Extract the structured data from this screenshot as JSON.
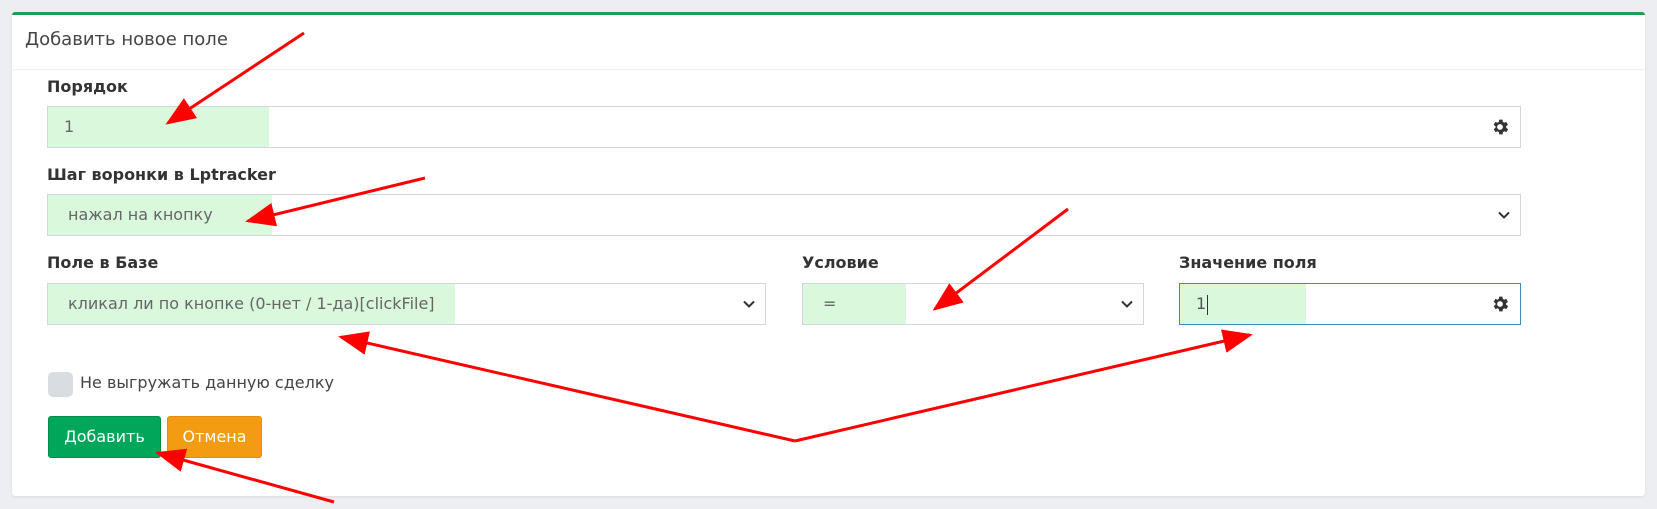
{
  "header": {
    "title": "Добавить новое поле"
  },
  "form": {
    "order": {
      "label": "Порядок",
      "value": "1",
      "icon": "gear-icon"
    },
    "funnel_step": {
      "label": "Шаг воронки в Lptracker",
      "selected": "нажал на кнопку"
    },
    "db_field": {
      "label": "Поле в Базе",
      "selected": "кликал ли по кнопке (0-нет / 1-да)[clickFile]"
    },
    "condition": {
      "label": "Условие",
      "selected": "="
    },
    "field_value": {
      "label": "Значение поля",
      "value": "1",
      "icon": "gear-icon"
    },
    "no_export": {
      "label": "Не выгружать данную сделку",
      "checked": false
    }
  },
  "buttons": {
    "add": "Добавить",
    "cancel": "Отмена"
  },
  "colors": {
    "highlight": "#d9f8dc",
    "annotation_arrow": "#ff0000",
    "add_button": "#00a65a",
    "cancel_button": "#f39c12",
    "header_accent": "#1f9d55"
  }
}
